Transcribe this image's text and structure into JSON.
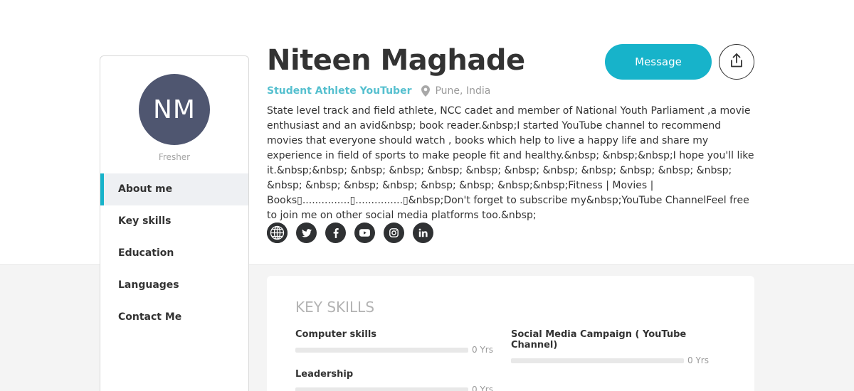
{
  "profile": {
    "initials": "NM",
    "status": "Fresher",
    "name": "Niteen Maghade",
    "headline": "Student Athlete YouTuber",
    "location": "Pune, India",
    "bio": "State level track and field athlete, NCC cadet and member of National Youth Parliament ,a movie enthusiast and an avid&nbsp; book reader.&nbsp;I started YouTube channel to recommend movies that everyone should watch , books which help to live a happy life and share my experience in field of sports to make people fit and healthy.&nbsp; &nbsp;&nbsp;I hope you'll like it.&nbsp;&nbsp; &nbsp; &nbsp; &nbsp; &nbsp; &nbsp; &nbsp; &nbsp; &nbsp; &nbsp; &nbsp; &nbsp; &nbsp; &nbsp; &nbsp; &nbsp; &nbsp; &nbsp;&nbsp;Fitness | Movies | Books▯...............▯...............▯&nbsp;Don't forget to subscribe my&nbsp;YouTube ChannelFeel free to join me on other social media platforms too.&nbsp;"
  },
  "nav": {
    "items": [
      {
        "label": "About me",
        "active": true
      },
      {
        "label": "Key skills"
      },
      {
        "label": "Education"
      },
      {
        "label": "Languages"
      },
      {
        "label": "Contact Me"
      }
    ]
  },
  "actions": {
    "message_label": "Message",
    "share_icon": "share-icon"
  },
  "social": {
    "icons": [
      "globe-icon",
      "twitter-icon",
      "facebook-icon",
      "youtube-icon",
      "instagram-icon",
      "linkedin-icon"
    ]
  },
  "skills": {
    "title": "KEY SKILLS",
    "items": [
      {
        "name": "Computer skills",
        "years": "0 Yrs"
      },
      {
        "name": "Social Media Campaign ( YouTube Channel)",
        "years": "0 Yrs"
      },
      {
        "name": "Leadership",
        "years": "0 Yrs"
      }
    ]
  },
  "colors": {
    "accent": "#17b3ca",
    "avatar": "#4f5670",
    "headline": "#56c0cf"
  }
}
